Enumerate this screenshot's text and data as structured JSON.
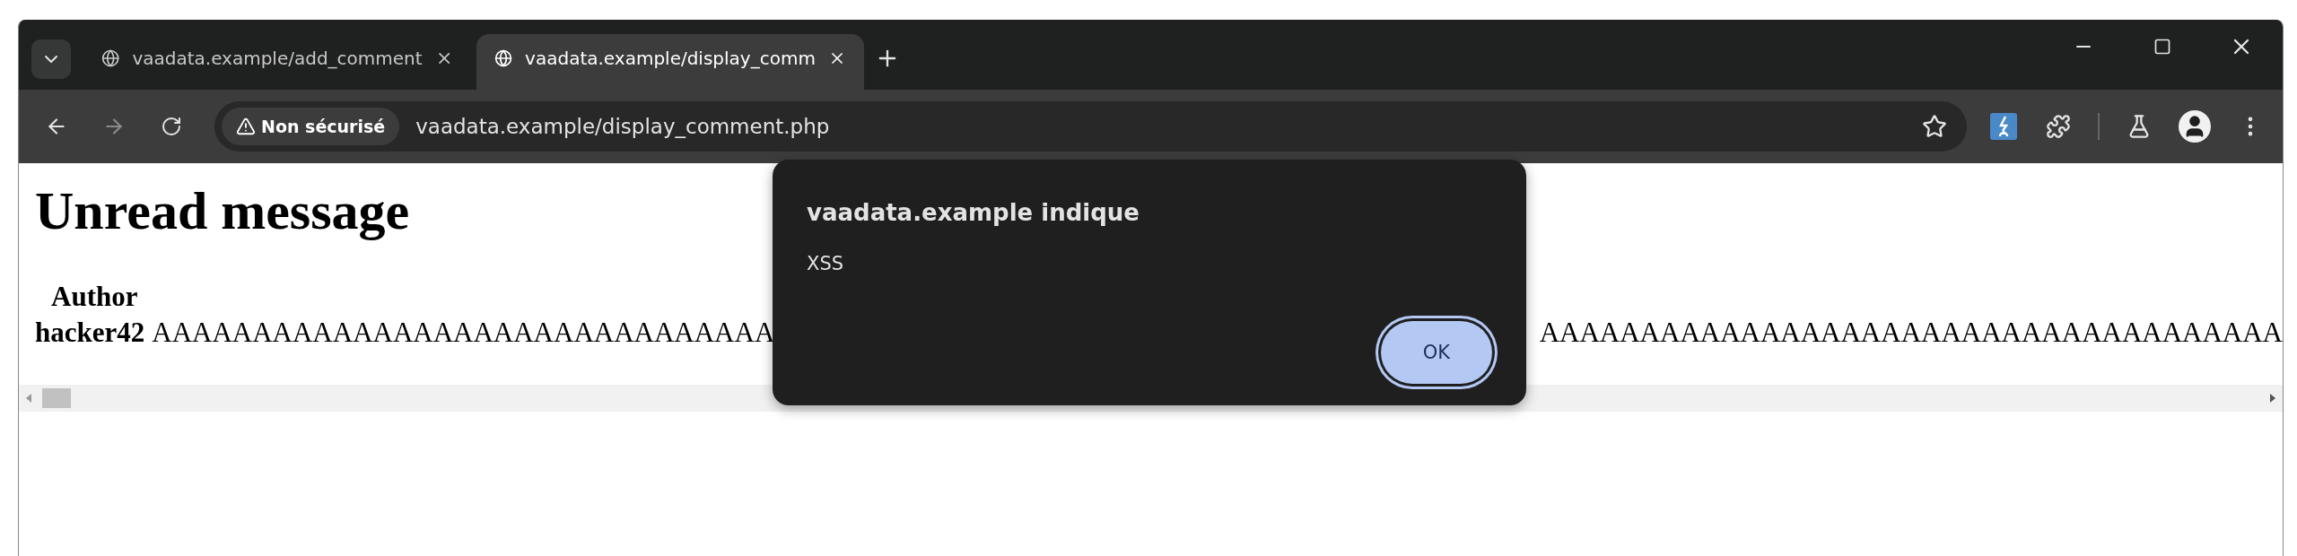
{
  "tabs": [
    {
      "title": "vaadata.example/add_comment",
      "selected": false
    },
    {
      "title": "vaadata.example/display_comm",
      "selected": true
    }
  ],
  "toolbar": {
    "security_label": "Non sécurisé",
    "url": "vaadata.example/display_comment.php"
  },
  "page": {
    "heading": "Unread message",
    "table": {
      "columns": [
        "Author"
      ],
      "rows": [
        {
          "author": "hacker42",
          "comment_parts": [
            "AAAAAAAAAAAAAAAAAAAAAAAAAAAAAAA",
            "AAAAAAAAAAAAAAAAAAAAAAAAAAAAAAAAAAAAA"
          ]
        }
      ]
    }
  },
  "dialog": {
    "title": "vaadata.example indique",
    "message": "XSS",
    "buttons": [
      {
        "label": "OK",
        "focused": true
      }
    ]
  }
}
